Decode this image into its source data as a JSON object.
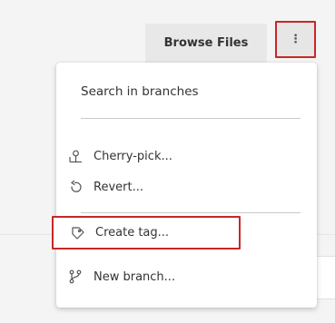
{
  "toolbar": {
    "browse_files_label": "Browse Files",
    "more_actions_label": "⋮"
  },
  "menu": {
    "items": [
      {
        "id": "search-in-branches",
        "label": "Search in branches",
        "icon": null
      },
      {
        "id": "cherry-pick",
        "label": "Cherry-pick...",
        "icon": "cherry-pick-icon"
      },
      {
        "id": "revert",
        "label": "Revert...",
        "icon": "revert-icon"
      },
      {
        "id": "create-tag",
        "label": "Create tag...",
        "icon": "tag-icon"
      },
      {
        "id": "new-branch",
        "label": "New branch...",
        "icon": "branch-icon"
      }
    ]
  },
  "colors": {
    "highlight": "#c62828",
    "text": "#333333",
    "icon": "#555555",
    "button_bg": "#e8e8e8"
  }
}
